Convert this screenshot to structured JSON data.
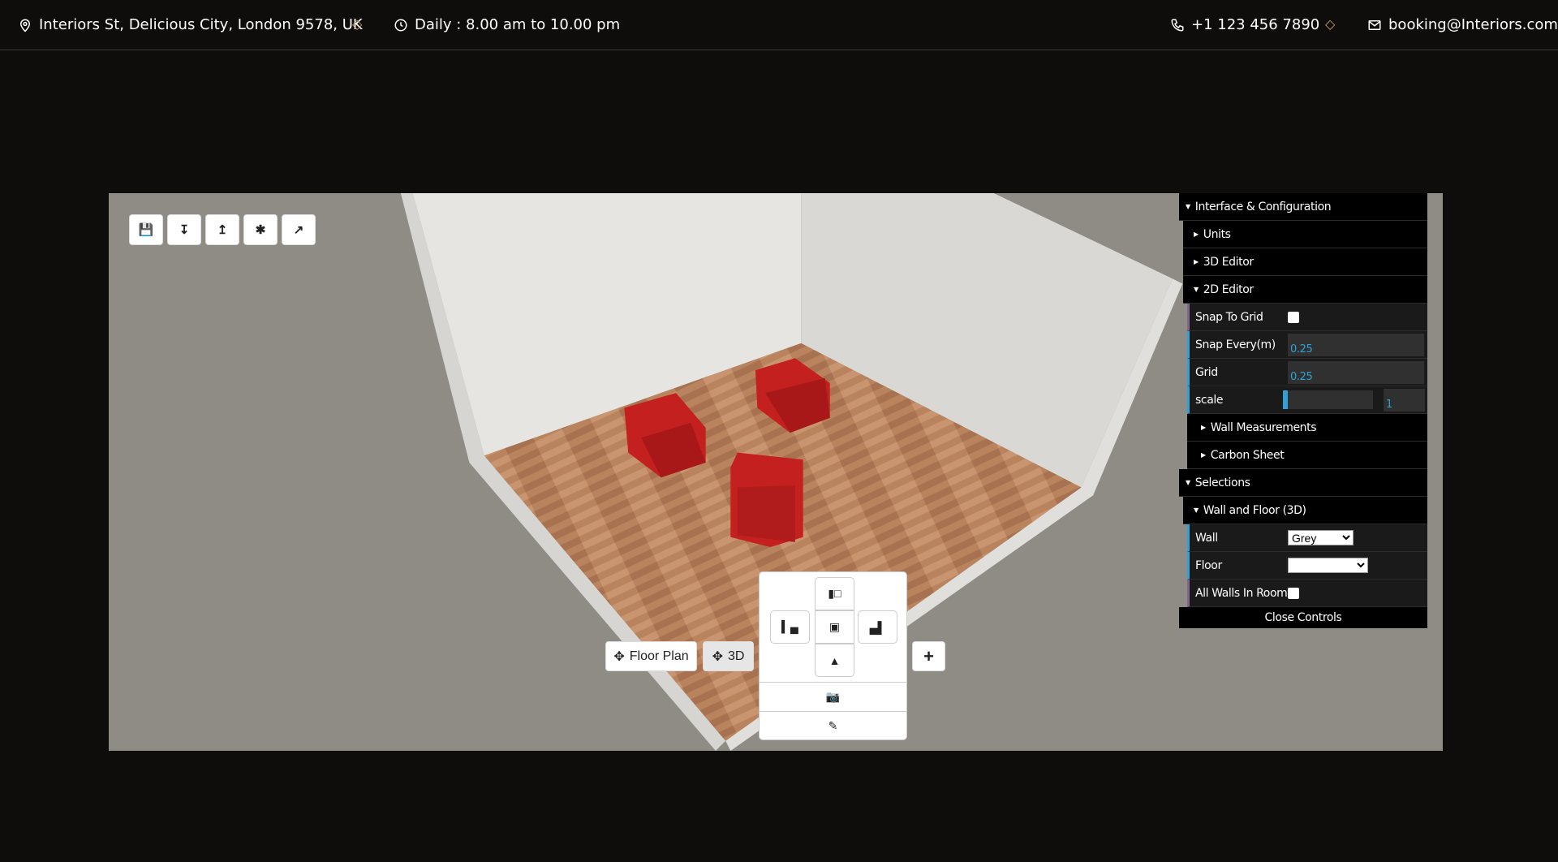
{
  "topbar": {
    "address": "Interiors St, Delicious City, London 9578, UK",
    "hours": "Daily : 8.00 am to 10.00 pm",
    "phone": "+1 123 456 7890",
    "email": "booking@Interiors.com",
    "separator": "◇"
  },
  "toolbar": {
    "icons": [
      "save-icon",
      "load-icon",
      "export-icon",
      "reset-icon",
      "share-icon"
    ]
  },
  "view_buttons": {
    "floor_plan": "Floor Plan",
    "three_d": "3D",
    "add": "+"
  },
  "camera_controls": {
    "icons": [
      "view-back-icon",
      "view-left-icon",
      "view-top-icon",
      "view-right-icon",
      "view-front-icon",
      "camera-icon",
      "pencil-icon"
    ]
  },
  "panel": {
    "interface": "Interface & Configuration",
    "units": "Units",
    "editor3d": "3D Editor",
    "editor2d": "2D Editor",
    "snap_to_grid": "Snap To Grid",
    "snap_every": "Snap Every(m)",
    "snap_every_value": "0.25",
    "grid": "Grid",
    "grid_value": "0.25",
    "scale": "scale",
    "scale_value": "1",
    "scale_fraction": 0.05,
    "wall_measurements": "Wall Measurements",
    "carbon_sheet": "Carbon Sheet",
    "selections": "Selections",
    "wall_floor": "Wall and Floor (3D)",
    "wall": "Wall",
    "wall_value": "Grey",
    "floor": "Floor",
    "floor_value": "",
    "all_walls": "All Walls In Room",
    "close": "Close Controls",
    "accent": "#2fa1d6"
  }
}
